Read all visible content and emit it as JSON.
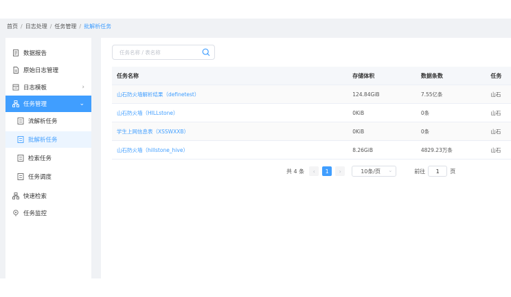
{
  "breadcrumb": {
    "items": [
      "首页",
      "日志处理",
      "任务管理"
    ],
    "separator": "/",
    "current": "批解析任务"
  },
  "sidebar": {
    "items": [
      {
        "label": "数据报告",
        "icon": "report-icon"
      },
      {
        "label": "原始日志管理",
        "icon": "document-icon"
      },
      {
        "label": "日志模板",
        "icon": "template-icon",
        "arrow": "›"
      },
      {
        "label": "任务管理",
        "icon": "task-icon",
        "arrow": "⌄",
        "expanded": true
      },
      {
        "label": "流解析任务",
        "icon": "list-icon"
      },
      {
        "label": "批解析任务",
        "icon": "list-icon",
        "active": true
      },
      {
        "label": "检索任务",
        "icon": "list-icon"
      },
      {
        "label": "任务调度",
        "icon": "list-icon"
      },
      {
        "label": "快速检索",
        "icon": "search-task-icon"
      },
      {
        "label": "任务监控",
        "icon": "monitor-icon"
      }
    ]
  },
  "search": {
    "placeholder": "任务名称 / 表名称",
    "value": ""
  },
  "table": {
    "columns": [
      "任务名称",
      "存储体积",
      "数据条数",
      "任务"
    ],
    "rows": [
      {
        "name": "山石防火墙解析结果（definetest）",
        "size": "124.84GiB",
        "count": "7.55亿条",
        "extra": "山石"
      },
      {
        "name": "山石防火墙（HILLstone）",
        "size": "0KiB",
        "count": "0条",
        "extra": "山石"
      },
      {
        "name": "学生上网信息表（XSSWXXB）",
        "size": "0KiB",
        "count": "0条",
        "extra": "山石"
      },
      {
        "name": "山石防火墙（hillstone_hive）",
        "size": "8.26GiB",
        "count": "4829.23万条",
        "extra": "山石"
      }
    ]
  },
  "pagination": {
    "total_text": "共 4 条",
    "prev": "‹",
    "current_page": "1",
    "next": "›",
    "page_size": "10条/页",
    "goto_label": "前往",
    "goto_value": "1",
    "page_unit": "页"
  },
  "colors": {
    "accent": "#409eff",
    "page_bg": "#f0f2f5"
  }
}
